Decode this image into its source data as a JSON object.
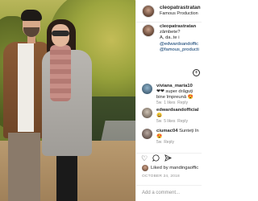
{
  "header": {
    "username": "cleopatrastratan",
    "subtitle": "Famous Production"
  },
  "caption": {
    "username": "cleopatrastratan",
    "text": "zâmbete?",
    "text_cont": "A, da..te i",
    "tag1": "@edwardsandoffic",
    "tag2": "@famous_producti"
  },
  "comments": [
    {
      "username": "viviana_maria10",
      "text": "❤❤ super drăguți",
      "text2": "bine împreună 😍",
      "time": "5w",
      "likes": "1 likes",
      "reply": "Reply"
    },
    {
      "username": "edwardsandofficial",
      "text": "😀",
      "time": "5w",
      "likes": "5 likes",
      "reply": "Reply"
    },
    {
      "username": "ciumac04",
      "text": "Sunteți în",
      "text2": "😍",
      "time": "5w",
      "likes": "",
      "reply": "Reply"
    }
  ],
  "likes_text": "Liked by mandingaoffic",
  "date": "OCTOBER 24, 2018",
  "add_comment_placeholder": "Add a comment...",
  "icons": {
    "add": "plus-circle-icon",
    "like": "heart-icon",
    "comment": "speech-bubble-icon",
    "share": "paper-plane-icon"
  }
}
